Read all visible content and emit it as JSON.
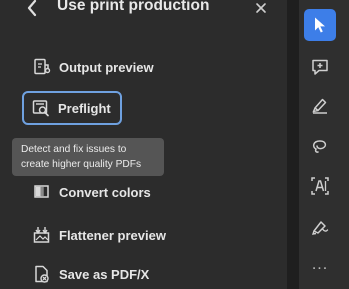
{
  "panel": {
    "title": "Use print production",
    "back_icon": "chevron-left-icon",
    "close_icon": "close-icon",
    "items": [
      {
        "label": "Output preview",
        "icon": "output-preview-icon"
      },
      {
        "label": "Preflight",
        "icon": "preflight-icon",
        "state": "focused"
      },
      {
        "label": "Convert colors",
        "icon": "convert-colors-icon"
      },
      {
        "label": "Flattener preview",
        "icon": "flattener-preview-icon"
      },
      {
        "label": "Save as PDF/X",
        "icon": "save-as-pdfx-icon"
      }
    ]
  },
  "tooltip": {
    "line1": "Detect and fix issues to",
    "line2": "create higher quality PDFs"
  },
  "toolbar": {
    "tools": [
      {
        "name": "select-tool",
        "icon": "cursor-arrow-icon",
        "active": true
      },
      {
        "name": "add-comment-tool",
        "icon": "comment-add-icon"
      },
      {
        "name": "highlight-tool",
        "icon": "highlighter-icon"
      },
      {
        "name": "draw-tool",
        "icon": "freehand-lasso-icon"
      },
      {
        "name": "text-select-tool",
        "icon": "text-box-icon"
      },
      {
        "name": "sign-tool",
        "icon": "pen-sign-icon"
      }
    ],
    "more_label": "..."
  },
  "colors": {
    "panel_bg": "#2c2c2c",
    "toolbar_bg": "#2f2f2f",
    "divider": "#1f1f1f",
    "accent": "#3d7ee8",
    "focus_ring": "#6fa1e0",
    "tooltip_bg": "#555555",
    "text": "#e6e6e6"
  }
}
